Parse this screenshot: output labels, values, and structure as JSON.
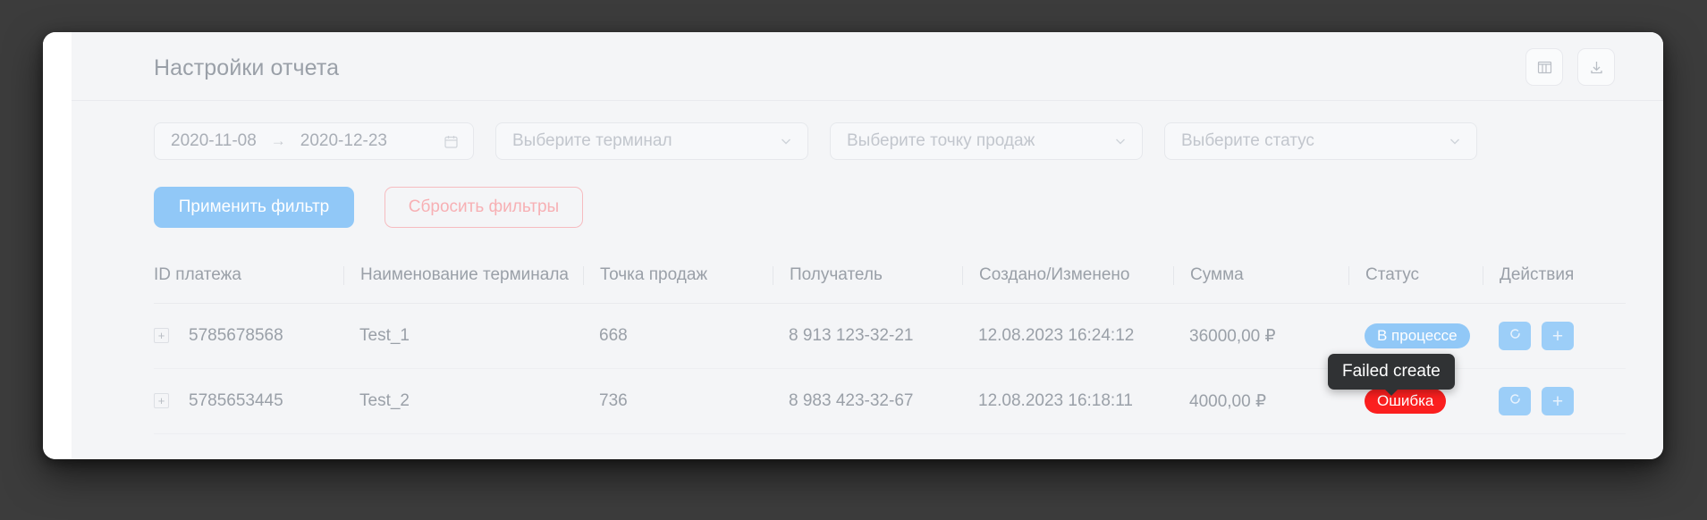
{
  "header": {
    "title": "Настройки отчета",
    "actions": [
      {
        "icon": "columns-settings-icon"
      },
      {
        "icon": "download-icon"
      }
    ]
  },
  "filters": {
    "date_range": {
      "start": "2020-11-08",
      "end": "2020-12-23",
      "separator": "→",
      "icon": "calendar-icon"
    },
    "terminal_select": {
      "placeholder": "Выберите терминал",
      "icon": "chevron-down-icon"
    },
    "point_select": {
      "placeholder": "Выберите точку продаж",
      "icon": "chevron-down-icon"
    },
    "status_select": {
      "placeholder": "Выберите статус",
      "icon": "chevron-down-icon"
    }
  },
  "buttons": {
    "apply": "Применить фильтр",
    "reset": "Сбросить фильтры"
  },
  "table": {
    "columns": [
      "ID платежа",
      "Наименование терминала",
      "Точка продаж",
      "Получатель",
      "Создано/Изменено",
      "Сумма",
      "Статус",
      "Действия"
    ],
    "rows": [
      {
        "id": "5785678568",
        "terminal": "Test_1",
        "point": "668",
        "receiver": "8 913 123-32-21",
        "datetime": "12.08.2023 16:24:12",
        "amount": "36000,00 ₽",
        "status": "В процессе",
        "status_type": "progress",
        "actions": [
          "refresh-icon",
          "plus-icon"
        ]
      },
      {
        "id": "5785653445",
        "terminal": "Test_2",
        "point": "736",
        "receiver": "8 983 423-32-67",
        "datetime": "12.08.2023 16:18:11",
        "amount": "4000,00 ₽",
        "status": "Ошибка",
        "status_type": "error",
        "actions": [
          "refresh-icon",
          "plus-icon"
        ]
      }
    ]
  },
  "tooltip": {
    "text": "Failed create"
  },
  "colors": {
    "primary": "#91c8f7",
    "danger_outline": "#f6bcc0",
    "error_badge": "#fb1f1f",
    "progress_badge": "#91c8f7",
    "tooltip_bg": "#303234",
    "page_bg": "#3c3c3c",
    "card_bg": "#f4f5f7"
  }
}
